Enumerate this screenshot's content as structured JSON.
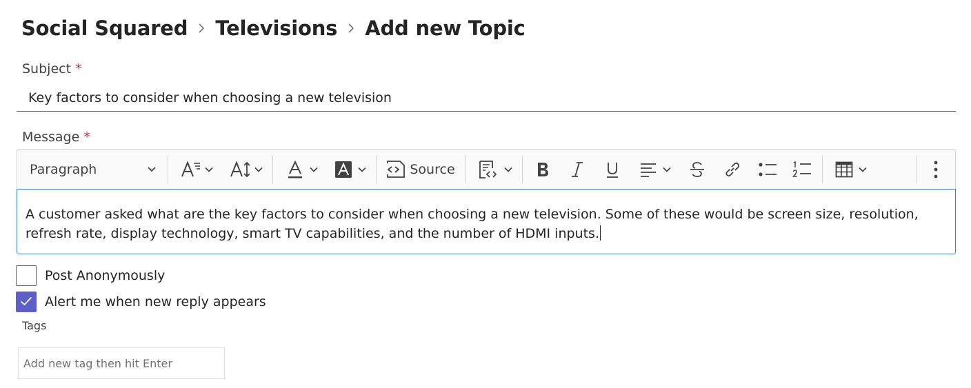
{
  "breadcrumb": {
    "items": [
      "Social Squared",
      "Televisions",
      "Add new Topic"
    ]
  },
  "subject": {
    "label": "Subject",
    "required_mark": "*",
    "value": "Key factors to consider when choosing a new television"
  },
  "message": {
    "label": "Message",
    "required_mark": "*",
    "content": "A customer asked what are the key factors to consider when choosing a new television. Some of these would be screen size, resolution, refresh rate, display technology, smart TV capabilities, and the number of HDMI inputs."
  },
  "toolbar": {
    "block_format": "Paragraph",
    "source_label": "Source",
    "icons": [
      "chevron-down-icon",
      "font-size-icon",
      "line-height-icon",
      "font-color-icon",
      "highlight-color-icon",
      "source-code-icon",
      "insert-template-icon",
      "bold-icon",
      "italic-icon",
      "underline-icon",
      "align-icon",
      "strikethrough-icon",
      "link-icon",
      "bulleted-list-icon",
      "numbered-list-icon",
      "table-icon",
      "more-options-icon"
    ]
  },
  "options": {
    "post_anonymously": {
      "label": "Post Anonymously",
      "checked": false
    },
    "alert_me": {
      "label": "Alert me when new reply appears",
      "checked": true
    }
  },
  "tags": {
    "label": "Tags",
    "placeholder": "Add new tag then hit Enter"
  },
  "colors": {
    "accent": "#5b5fc7",
    "required": "#c4314b",
    "editor_focus_border": "#3f7fcf"
  }
}
